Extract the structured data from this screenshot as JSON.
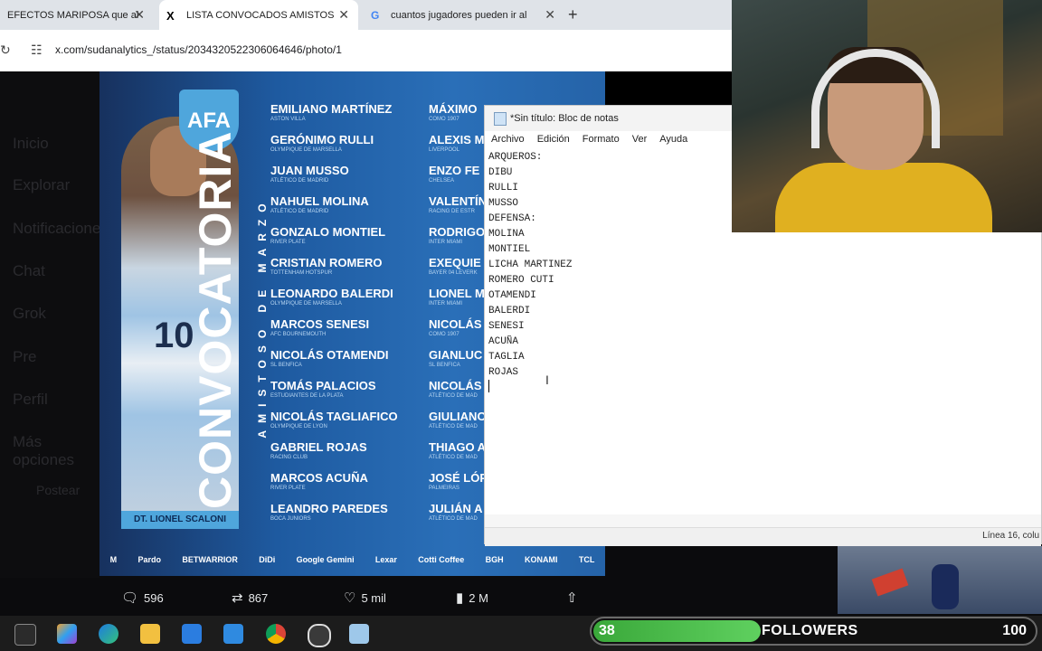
{
  "browser": {
    "tabs": [
      {
        "title": "EFECTOS MARIPOSA que al"
      },
      {
        "title": "LISTA CONVOCADOS AMISTOS"
      },
      {
        "title": "cuantos jugadores pueden ir al"
      }
    ],
    "url": "x.com/sudanalytics_/status/2034320522306064646/photo/1"
  },
  "x_sidebar": [
    "Inicio",
    "Explorar",
    "Notificaciones",
    "Chat",
    "Grok",
    "Pre",
    "Perfil",
    "Más opciones",
    "Postear"
  ],
  "poster": {
    "badge": "AFA",
    "title": "CONVOCATORIA",
    "subtitle": "AMISTOSO DE MARZO",
    "coach": "DT. LIONEL SCALONI",
    "jersey_number": "10",
    "col1": [
      {
        "name": "EMILIANO MARTÍNEZ",
        "club": "ASTON VILLA"
      },
      {
        "name": "GERÓNIMO RULLI",
        "club": "OLYMPIQUE DE MARSELLA"
      },
      {
        "name": "JUAN MUSSO",
        "club": "ATLÉTICO DE MADRID"
      },
      {
        "name": "NAHUEL MOLINA",
        "club": "ATLÉTICO DE MADRID"
      },
      {
        "name": "GONZALO MONTIEL",
        "club": "RIVER PLATE"
      },
      {
        "name": "CRISTIAN ROMERO",
        "club": "TOTTENHAM HOTSPUR"
      },
      {
        "name": "LEONARDO BALERDI",
        "club": "OLYMPIQUE DE MARSELLA"
      },
      {
        "name": "MARCOS SENESI",
        "club": "AFC BOURNEMOUTH"
      },
      {
        "name": "NICOLÁS OTAMENDI",
        "club": "SL BENFICA"
      },
      {
        "name": "TOMÁS PALACIOS",
        "club": "ESTUDIANTES DE LA PLATA"
      },
      {
        "name": "NICOLÁS TAGLIAFICO",
        "club": "OLYMPIQUE DE LYON"
      },
      {
        "name": "GABRIEL ROJAS",
        "club": "RACING CLUB"
      },
      {
        "name": "MARCOS ACUÑA",
        "club": "RIVER PLATE"
      },
      {
        "name": "LEANDRO PAREDES",
        "club": "BOCA JUNIORS"
      }
    ],
    "col2": [
      {
        "name": "MÁXIMO",
        "club": "COMO 1907"
      },
      {
        "name": "ALEXIS M",
        "club": "LIVERPOOL"
      },
      {
        "name": "ENZO FE",
        "club": "CHELSEA"
      },
      {
        "name": "VALENTÍN",
        "club": "RACING DE ESTR"
      },
      {
        "name": "RODRIGO",
        "club": "INTER MIAMI"
      },
      {
        "name": "EXEQUIE",
        "club": "BAYER 04 LEVERK"
      },
      {
        "name": "LIONEL M",
        "club": "INTER MIAMI"
      },
      {
        "name": "NICOLÁS",
        "club": "COMO 1907"
      },
      {
        "name": "GIANLUC",
        "club": "SL BENFICA"
      },
      {
        "name": "NICOLÁS",
        "club": "ATLÉTICO DE MAD"
      },
      {
        "name": "GIULIANO",
        "club": "ATLÉTICO DE MAD"
      },
      {
        "name": "THIAGO A",
        "club": "ATLÉTICO DE MAD"
      },
      {
        "name": "JOSÉ LÓP",
        "club": "PALMEIRAS"
      },
      {
        "name": "JULIÁN A",
        "club": "ATLÉTICO DE MAD"
      }
    ],
    "sponsors": [
      "M",
      "Pardo",
      "BETWARRIOR",
      "DiDi",
      "Google Gemini",
      "Lexar",
      "Cotti Coffee",
      "BGH",
      "KONAMI",
      "TCL"
    ]
  },
  "tweet_actions": {
    "replies": "596",
    "reposts": "867",
    "likes": "5 mil",
    "views": "2 M"
  },
  "notepad": {
    "title": "*Sin título: Bloc de notas",
    "menu": [
      "Archivo",
      "Edición",
      "Formato",
      "Ver",
      "Ayuda"
    ],
    "content": "ARQUEROS:\nDIBU\nRULLI\nMUSSO\nDEFENSA:\nMOLINA\nMONTIEL\nLICHA MARTINEZ\nROMERO CUTI\nOTAMENDI\nBALERDI\nSENESI\nACUÑA\nTAGLIA\nROJAS",
    "status": "Línea 16, colu"
  },
  "followers_widget": {
    "current": "38",
    "label": "FOLLOWERS",
    "goal": "100"
  },
  "colors": {
    "followers_bar": "#4cc04c",
    "poster_blue": "#1e5aa0",
    "afa_badge": "#4fa6dc"
  }
}
